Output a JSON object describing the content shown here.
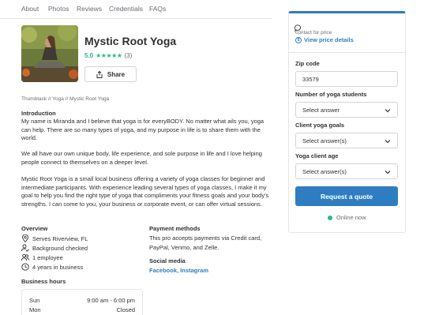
{
  "nav": {
    "items": [
      "About",
      "Photos",
      "Reviews",
      "Credentials",
      "FAQs"
    ]
  },
  "profile": {
    "name": "Mystic Root Yoga",
    "rating": "5.0",
    "stars": "★★★★★",
    "review_count": "(3)",
    "share_label": "Share"
  },
  "breadcrumb": "Thumbtack // Yoga // Mystic Root Yoga",
  "intro": {
    "heading": "Introduction",
    "p1": "My name is Miranda and I believe that yoga is for everyBODY. No matter what ails you, yoga can help. There are so many types of yoga, and my purpose in life is to share them with the world.",
    "p2": "We all have our own unique body, life experience, and sole purpose in life and I love helping people connect to themselves on a deeper level.",
    "p3": "Mystic Root Yoga is a small local business offering a variety of yoga classes for beginner and intermediate participants. With experience leading several types of yoga classes, I make it my goal to help you find the right type of yoga that compliments your fitness goals and your body's strengths. I can come to you, your business or corporate event, or can offer virtual sessions."
  },
  "overview": {
    "heading": "Overview",
    "items": [
      {
        "icon": "location-pin-icon",
        "text": "Serves Riverview, FL"
      },
      {
        "icon": "person-check-icon",
        "text": "Background checked"
      },
      {
        "icon": "people-icon",
        "text": "1 employee"
      },
      {
        "icon": "clock-icon",
        "text": "4 years in business"
      }
    ]
  },
  "payment": {
    "heading": "Payment methods",
    "text": "This pro accepts payments via Credit card, PayPal, Venmo, and Zelle."
  },
  "social": {
    "heading": "Social media",
    "links": "Facebook, Instagram"
  },
  "hours": {
    "heading": "Business hours",
    "rows": [
      {
        "day": "Sun",
        "time": "9:00 am - 6:00 pm"
      },
      {
        "day": "Mon",
        "time": "Closed"
      }
    ]
  },
  "quote_card": {
    "contact_text": "contact for price",
    "view_price": "View price details",
    "zip_label": "Zip code",
    "zip_value": "33579",
    "students_label": "Number of yoga students",
    "students_value": "Select answer",
    "goals_label": "Client yoga goals",
    "goals_value": "Select answer(s)",
    "age_label": "Yoga client age",
    "age_value": "Select answer(s)",
    "button_label": "Request a quote",
    "online_status": "Online now"
  },
  "colors": {
    "accent": "#2f7dc1",
    "rating_green": "#2db783",
    "text": "#2f3033",
    "muted": "#676d73"
  }
}
